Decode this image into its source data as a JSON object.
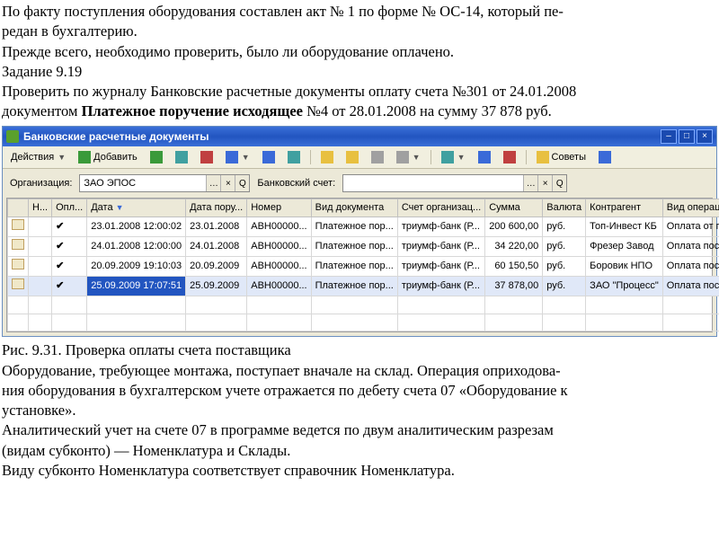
{
  "doc": {
    "p1a": "По факту поступления оборудования составлен акт № 1 по форме № ОС-14, который пе-",
    "p1b": "редан в бухгалтерию.",
    "p2": "Прежде всего, необходимо проверить, было ли оборудование оплачено.",
    "task_label": "Задание 9.19",
    "p3": "Проверить по журналу Банковские расчетные документы оплату счета №301 от 24.01.2008",
    "p4a": "документом ",
    "p4b_bold": "Платежное поручение исходящее",
    "p4c": " №4 от 28.01.2008 на сумму 37 878 руб.",
    "fig_caption": "Рис. 9.31. Проверка оплаты счета поставщика",
    "p5a": "Оборудование, требующее монтажа, поступает вначале на склад. Операция оприходова-",
    "p5b": "ния оборудования в бухгалтерском учете отражается по дебету счета 07 «Оборудование к",
    "p5c": "установке».",
    "p6a": "Аналитический учет на счете 07 в программе ведется по двум аналитическим разрезам",
    "p6b": "(видам субконто) — Номенклатура и Склады.",
    "p7": "Виду субконто Номенклатура соответствует справочник Номенклатура."
  },
  "window": {
    "title": "Банковские расчетные документы",
    "toolbar": {
      "actions": "Действия",
      "add": "Добавить",
      "tips": "Советы"
    },
    "filter": {
      "org_label": "Организация:",
      "org_value": "ЗАО ЭПОС",
      "acct_label": "Банковский счет:",
      "acct_value": ""
    },
    "columns": {
      "c0": "",
      "c1": "Н...",
      "c2": "Опл...",
      "c3": "Дата",
      "c4": "Дата пору...",
      "c5": "Номер",
      "c6": "Вид документа",
      "c7": "Счет организац...",
      "c8": "Сумма",
      "c9": "Валюта",
      "c10": "Контрагент",
      "c11": "Вид операции"
    },
    "rows": [
      {
        "opl": "✔",
        "date": "23.01.2008 12:00:02",
        "pdate": "23.01.2008",
        "num": "АВН00000...",
        "vid": "Платежное пор...",
        "acct": "триумф-банк (Р...",
        "sum": "200 600,00",
        "cur": "руб.",
        "contr": "Топ-Инвест КБ",
        "op": "Оплата от по..."
      },
      {
        "opl": "✔",
        "date": "24.01.2008 12:00:00",
        "pdate": "24.01.2008",
        "num": "АВН00000...",
        "vid": "Платежное пор...",
        "acct": "триумф-банк (Р...",
        "sum": "34 220,00",
        "cur": "руб.",
        "contr": "Фрезер Завод",
        "op": "Оплата пост..."
      },
      {
        "opl": "✔",
        "date": "20.09.2009 19:10:03",
        "pdate": "20.09.2009",
        "num": "АВН00000...",
        "vid": "Платежное пор...",
        "acct": "триумф-банк (Р...",
        "sum": "60 150,50",
        "cur": "руб.",
        "contr": "Боровик НПО",
        "op": "Оплата пост..."
      },
      {
        "opl": "✔",
        "date": "25.09.2009 17:07:51",
        "pdate": "25.09.2009",
        "num": "АВН00000...",
        "vid": "Платежное пор...",
        "acct": "триумф-банк (Р...",
        "sum": "37 878,00",
        "cur": "руб.",
        "contr": "ЗАО \"Процесс\"",
        "op": "Оплата пост..."
      }
    ]
  }
}
